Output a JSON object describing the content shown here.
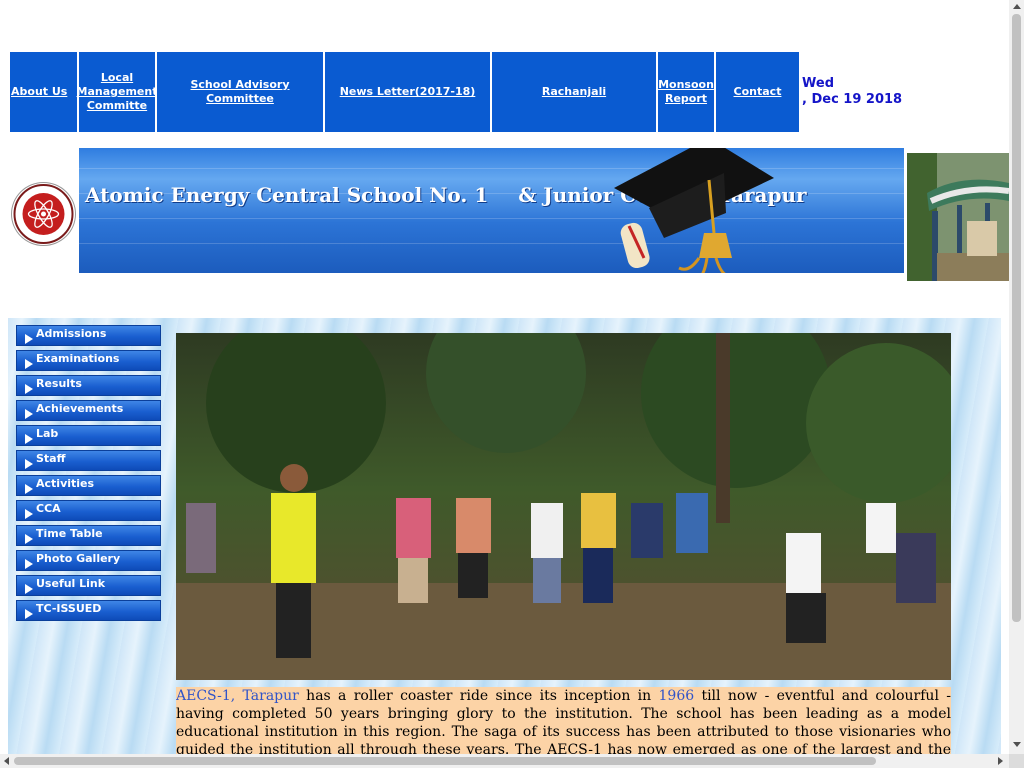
{
  "nav": {
    "items": [
      {
        "label": "About Us"
      },
      {
        "label": "Local Management Committe"
      },
      {
        "label": "School Advisory Committee"
      },
      {
        "label": "News Letter(2017-18)"
      },
      {
        "label": "Rachanjali"
      },
      {
        "label": "Monsoon Report"
      },
      {
        "label": "Contact"
      }
    ],
    "date_day": "Wed",
    "date_rest": ", Dec 19 2018"
  },
  "banner": {
    "title_part1": "Atomic Energy Central School No. 1",
    "title_part2": "& Junior College, Tarapur"
  },
  "sidebar": {
    "items": [
      {
        "label": "Admissions"
      },
      {
        "label": "Examinations"
      },
      {
        "label": "Results"
      },
      {
        "label": "Achievements"
      },
      {
        "label": "Lab"
      },
      {
        "label": "Staff"
      },
      {
        "label": "Activities"
      },
      {
        "label": "CCA"
      },
      {
        "label": "Time Table"
      },
      {
        "label": "Photo Gallery"
      },
      {
        "label": "Useful Link"
      },
      {
        "label": "TC-ISSUED"
      }
    ]
  },
  "intro": {
    "school_name": "AECS-1, Tarapur",
    "text1": " has a roller coaster ride since its inception in ",
    "year": "1966",
    "text2": " till now - eventful and colourful - having completed 50 years bringing glory to the institution. The school has been leading as a model educational institution in this region. The saga of its success has been attributed to those visionaries who guided the institution all through these years. The AECS-1 has now emerged as one of the largest and the best schools in Maharashtra. The transformation from TAPS"
  },
  "colors": {
    "nav_bg": "#0a5bd1",
    "date_text": "#1414c8",
    "intro_bg": "#fcd3a6",
    "intro_highlight": "#3154c8"
  }
}
